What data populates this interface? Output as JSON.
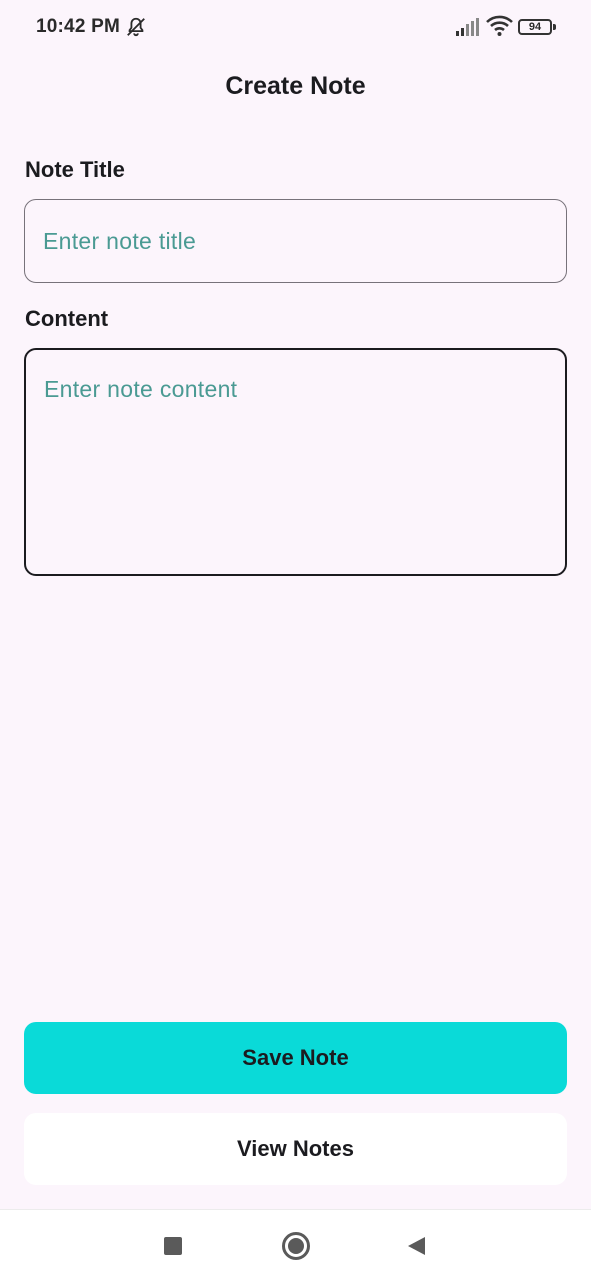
{
  "status_bar": {
    "time": "10:42 PM",
    "battery_level": "94",
    "icons": [
      "bell-off-icon",
      "signal-icon",
      "wifi-icon",
      "battery-icon"
    ]
  },
  "header": {
    "title": "Create Note"
  },
  "form": {
    "title_label": "Note Title",
    "title_placeholder": "Enter note title",
    "title_value": "",
    "content_label": "Content",
    "content_placeholder": "Enter note content",
    "content_value": ""
  },
  "actions": {
    "save_label": "Save Note",
    "view_label": "View Notes"
  },
  "nav_bar": {
    "icons": [
      "recents-icon",
      "home-icon",
      "back-icon"
    ]
  },
  "colors": {
    "background": "#fcf5fc",
    "accent": "#0adad8",
    "placeholder": "#4a9a93"
  }
}
